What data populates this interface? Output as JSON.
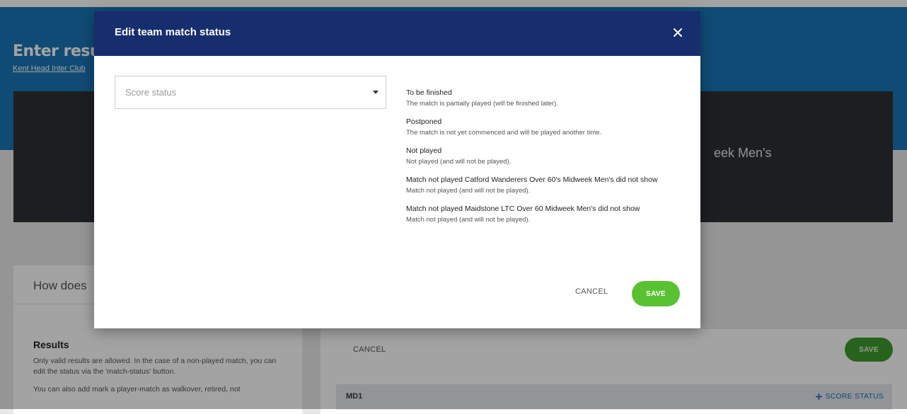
{
  "page": {
    "title": "Enter results",
    "breadcrumb": "Kent Head Inter Club",
    "hero_title": "eek Men's",
    "info": {
      "heading": "How does",
      "results_title": "Results",
      "text1": "Only valid results are allowed. In the case of a non-played match, you can edit the status via the 'match-status' button.",
      "text2": "You can also add mark a player-match as walkover, retired, not"
    },
    "cancel_label": "CANCEL",
    "save_label": "SAVE",
    "match_label": "MD1",
    "score_status_label": "SCORE STATUS"
  },
  "modal": {
    "title": "Edit team match status",
    "select": {
      "placeholder": "Score status"
    },
    "statuses": [
      {
        "title": "To be finished",
        "desc": "The match is partially played (will be finished later)."
      },
      {
        "title": "Postponed",
        "desc": "The match is not yet commenced and will be played another time."
      },
      {
        "title": "Not played",
        "desc": "Not played (and will not be played)."
      },
      {
        "title": "Match not played Catford Wanderers Over 60's Midweek Men's did not show",
        "desc": "Match not played (and will not be played)."
      },
      {
        "title": "Match not played Maidstone LTC Over 60 Midweek Men's did not show",
        "desc": "Match not played (and will not be played)."
      }
    ],
    "cancel_label": "CANCEL",
    "save_label": "SAVE"
  },
  "colors": {
    "header_blue": "#1a76b8",
    "modal_header": "#162d6e",
    "save_green": "#5ac232",
    "hero_dark": "#2e2f35"
  }
}
